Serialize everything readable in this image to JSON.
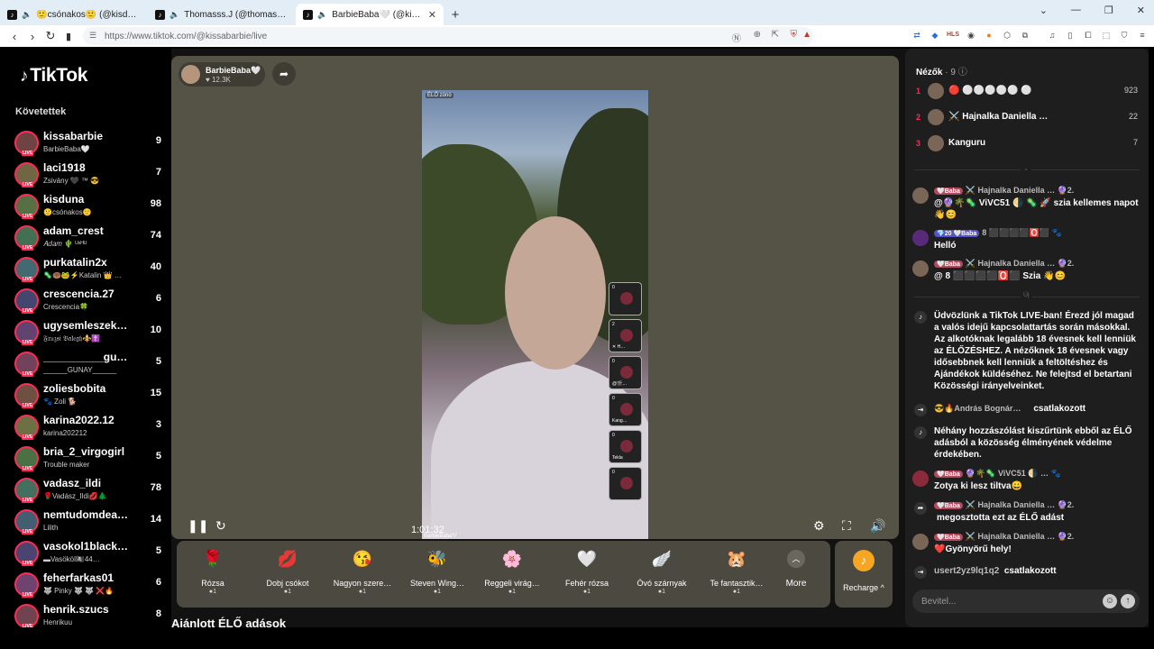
{
  "browser": {
    "tabs": [
      {
        "title": "🙂csónakos🙂 (@kisduna) ÉLŐ ·"
      },
      {
        "title": "Thomasss.J (@thomasssj0) ÉLŐ ·"
      },
      {
        "title": "BarbieBaba🤍 (@kissabarbie"
      }
    ],
    "new_tab": "+",
    "url": "https://www.tiktok.com/@kissabarbie/live",
    "ext_label": "HLS"
  },
  "sidebar": {
    "logo": "TikTok",
    "following_heading": "Követettek",
    "live_badge": "LIVE",
    "items": [
      {
        "name": "kissabarbie",
        "sub": "BarbieBaba🤍",
        "count": "9"
      },
      {
        "name": "laci1918",
        "sub": "Zsivány 🖤 ™ 😎",
        "count": "7"
      },
      {
        "name": "kisduna",
        "sub": "🙂csónakos🙂",
        "count": "98"
      },
      {
        "name": "adam_crest",
        "sub": "𝐴𝑑𝑎𝑚 🌵 ᵁˢᴴᵁ",
        "count": "74"
      },
      {
        "name": "purkatalin2x",
        "sub": "🦠🍩🐸⚡Katalin 👑 …",
        "count": "40"
      },
      {
        "name": "crescencia.27",
        "sub": "Crescencia🍀",
        "count": "6"
      },
      {
        "name": "ugysemleszek…",
        "sub": "𝔉𝔯𝔲𝔷𝔰𝔦 𝔅𝔞𝔩𝔢𝔤𝔥⚜️✝️",
        "count": "10"
      },
      {
        "name": "__________gunay…",
        "sub": "______GUNAY______",
        "count": "5"
      },
      {
        "name": "zoliesbobita",
        "sub": "🐾 Zoli 🐕",
        "count": "15"
      },
      {
        "name": "karina2022.12",
        "sub": "karina202212",
        "count": "3"
      },
      {
        "name": "bria_2_virgogirl",
        "sub": "Trouble maker",
        "count": "5"
      },
      {
        "name": "vadasz_ildi",
        "sub": "🌹Vadász_Ildi💋🌲",
        "count": "78"
      },
      {
        "name": "nemtudomdea…",
        "sub": "Lilith",
        "count": "14"
      },
      {
        "name": "vasokol1black…",
        "sub": "▬Vasököl🏴‍☠️44…",
        "count": "5"
      },
      {
        "name": "feherfarkas01",
        "sub": "🐺 Pinky 🐺 🐺 ❌🔥",
        "count": "6"
      },
      {
        "name": "henrik.szucs",
        "sub": "Henrikuu",
        "count": "8"
      }
    ]
  },
  "player": {
    "host_name": "BarbieBaba🤍",
    "host_likes": "♥ 12.3K",
    "live_label": "ÉLŐ zónó",
    "video_caption": "BarbieBaba🤍",
    "timer": "1:01:32",
    "guests": [
      {
        "score": "0",
        "label": ""
      },
      {
        "score": "2",
        "label": "✕ H…"
      },
      {
        "score": "0",
        "label": "@🎬…"
      },
      {
        "score": "0",
        "label": "Kang…"
      },
      {
        "score": "0",
        "label": "Tekla"
      },
      {
        "score": "0",
        "label": ""
      }
    ]
  },
  "gifts": [
    {
      "name": "Rózsa",
      "price": "1",
      "icon": "🌹"
    },
    {
      "name": "Dobj csókot",
      "price": "1",
      "icon": "💋"
    },
    {
      "name": "Nagyon szere…",
      "price": "1",
      "icon": "😘"
    },
    {
      "name": "Steven Wing…",
      "price": "1",
      "icon": "🐝"
    },
    {
      "name": "Reggeli virág…",
      "price": "1",
      "icon": "🌸"
    },
    {
      "name": "Fehér rózsa",
      "price": "1",
      "icon": "🤍"
    },
    {
      "name": "Óvó szárnyak",
      "price": "1",
      "icon": "🪽"
    },
    {
      "name": "Te fantasztik…",
      "price": "1",
      "icon": "🐹"
    }
  ],
  "more_label": "More",
  "recharge_label": "Recharge ^",
  "recommended_heading": "Ajánlott ÉLŐ adások",
  "chat": {
    "viewers_title": "Nézők",
    "viewers_count": "· 9",
    "top_viewers": [
      {
        "rank": "1",
        "name": "🔴 ⚪⚪⚪⚪⚪ ⚪",
        "score": "923"
      },
      {
        "rank": "2",
        "name": "⚔️ Hajnalka Daniella …",
        "score": "22"
      },
      {
        "rank": "3",
        "name": "Kanguru",
        "score": "7"
      }
    ],
    "separator_1": "⌄",
    "separator_2": "Új",
    "messages": [
      {
        "badges": "🤍Baba",
        "user": "⚔️ Hajnalka Daniella … 🔮2.",
        "text": "@🔮🌴🦠 ViVC51 🌗 🦠 🚀 szia kellemes napot 👋😊"
      },
      {
        "badges": "💎20  🤍Baba",
        "user": "8 ⬛⬛⬛⬛🅾️⬛ 🐾",
        "text": "Helló"
      },
      {
        "badges": "🤍Baba",
        "user": "⚔️ Hajnalka Daniella … 🔮2.",
        "text": "@ 8 ⬛⬛⬛⬛🅾️⬛ Szia 👋😊"
      },
      {
        "badges": "🤍Baba",
        "user": "🔮🌴🦠 ViVC51 🌗 … 🐾",
        "text": "Zotya ki lesz tiltva😀"
      },
      {
        "badges": "🤍Baba",
        "user": "⚔️ Hajnalka Daniella … 🔮2.",
        "text": "❤️Gyönyörű hely!"
      }
    ],
    "system_welcome": "Üdvözlünk a TikTok LIVE-ban! Érezd jól magad a valós idejű kapcsolattartás során másokkal. Az alkotóknak legalább 18 évesnek kell lenniük az ÉLŐZÉSHEZ. A nézőknek 18 évesnek vagy idősebbnek kell lenniük a feltöltéshez és Ajándékok küldéséhez. Ne felejtsd el betartani Közösségi irányelveinket.",
    "joined_1_user": "😎🔥András Bognár…",
    "joined_label": "csatlakozott",
    "system_filter": "Néhány hozzászólást kiszűrtünk ebből az ÉLŐ adásból a közösség élményének védelme érdekében.",
    "shared_user": "⚔️ Hajnalka Daniella … 🔮2.",
    "shared_text": "megosztotta ezt az ÉLŐ adást",
    "joined_2_user": "usert2yz9lq1q2",
    "input_placeholder": "Bevitel..."
  }
}
